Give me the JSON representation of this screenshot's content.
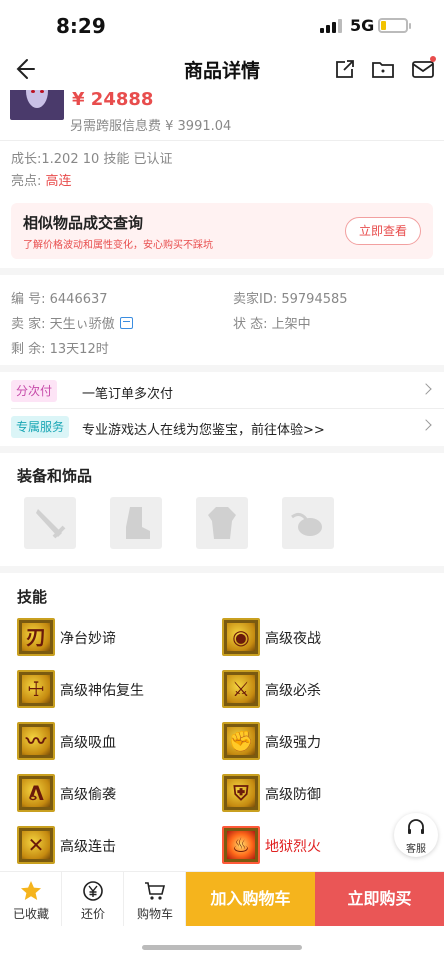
{
  "status_bar": {
    "time": "8:29",
    "network": "5G"
  },
  "nav": {
    "title": "商品详情"
  },
  "product": {
    "price": "¥ 24888",
    "fee": "另需跨服信息费 ¥ 3991.04",
    "growth": "成长:1.202 10 技能 已认证",
    "highlight_label": "亮点: ",
    "highlight_value": "高连"
  },
  "similar_query": {
    "title": "相似物品成交查询",
    "subtitle": "了解价格波动和属性变化，安心购买不踩坑",
    "button": "立即查看"
  },
  "info": {
    "id": "编 号: 6446637",
    "seller_id": "卖家ID:  59794585",
    "seller": "卖 家: 天生ぃ骄傲",
    "status": "状 态: 上架中",
    "remaining": "剩 余: 13天12时"
  },
  "services": [
    {
      "tag": "分次付",
      "text": "一笔订单多次付"
    },
    {
      "tag": "专属服务",
      "text": "专业游戏达人在线为您鉴宝，前往体验>>"
    }
  ],
  "equipment": {
    "title": "装备和饰品"
  },
  "skills": {
    "title": "技能",
    "items": [
      {
        "name": "净台妙谛",
        "glyph": "刃"
      },
      {
        "name": "高级夜战",
        "glyph": "◉"
      },
      {
        "name": "高级神佑复生",
        "glyph": "☩"
      },
      {
        "name": "高级必杀",
        "glyph": "⚔"
      },
      {
        "name": "高级吸血",
        "glyph": "〰"
      },
      {
        "name": "高级强力",
        "glyph": "✊"
      },
      {
        "name": "高级偷袭",
        "glyph": "ᕕ"
      },
      {
        "name": "高级防御",
        "glyph": "⛨"
      },
      {
        "name": "高级连击",
        "glyph": "✕"
      },
      {
        "name": "地狱烈火",
        "glyph": "♨",
        "color": "#e02020"
      }
    ]
  },
  "cs": {
    "label": "客服"
  },
  "bottom_bar": {
    "favorite": "已收藏",
    "bargain": "还价",
    "cart": "购物车",
    "add_cart": "加入购物车",
    "buy_now": "立即购买"
  },
  "colors": {
    "accent_red": "#e84d4d",
    "cart_yellow": "#f5b41d",
    "buy_red": "#ea5656"
  }
}
